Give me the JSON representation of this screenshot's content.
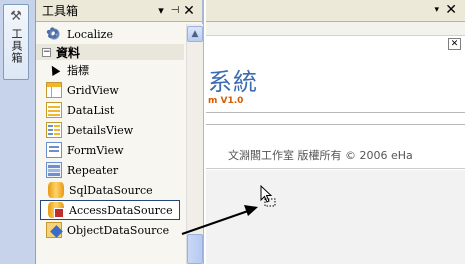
{
  "side_tab": {
    "label": "工具箱",
    "icon": "toolbox-icon"
  },
  "toolbox": {
    "title": "工具箱",
    "controls": {
      "dropdown": "▾",
      "pin": "⊣",
      "close": "✕"
    },
    "items_top": [
      {
        "label": "Localize",
        "icon": "gear-icon"
      }
    ],
    "group": {
      "label": "資料",
      "toggle": "−"
    },
    "items": [
      {
        "label": "指標",
        "icon": "pointer-icon"
      },
      {
        "label": "GridView",
        "icon": "gridview-icon"
      },
      {
        "label": "DataList",
        "icon": "datalist-icon"
      },
      {
        "label": "DetailsView",
        "icon": "detailsview-icon"
      },
      {
        "label": "FormView",
        "icon": "formview-icon"
      },
      {
        "label": "Repeater",
        "icon": "repeater-icon"
      },
      {
        "label": "SqlDataSource",
        "icon": "sqldatasource-icon"
      },
      {
        "label": "AccessDataSource",
        "icon": "accessdatasource-icon",
        "selected": true
      },
      {
        "label": "ObjectDataSource",
        "icon": "objectdatasource-icon"
      }
    ]
  },
  "designer": {
    "titlebar": {
      "dropdown": "▾",
      "close": "✕"
    },
    "mini_close": "✕",
    "banner_title": "系統",
    "banner_version": "m V1.0",
    "footer": "文淵閣工作室   版權所有 © 2006 eHa"
  },
  "colors": {
    "accent": "#3b6cb0",
    "version": "#d95a00",
    "selection_border": "#26457a"
  }
}
